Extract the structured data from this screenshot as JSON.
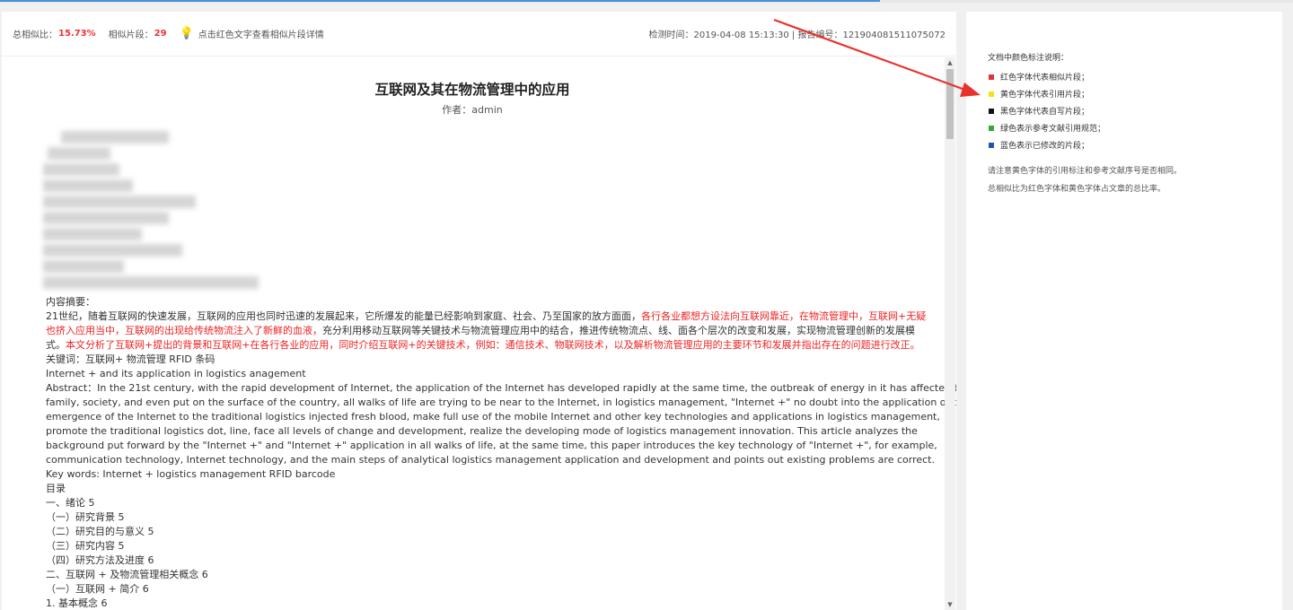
{
  "info_bar": {
    "total_label": "总相似比：",
    "total_value": "15.73%",
    "fragments_label": "相似片段：",
    "fragments_value": "29",
    "hint": "点击红色文字查看相似片段详情",
    "meta": "检测时间：2019-04-08 15:13:30 | 报告编号：121904081511075072"
  },
  "document": {
    "title": "互联网及其在物流管理中的应用",
    "author": "作者：admin",
    "lines": [
      {
        "segments": [
          {
            "text": "内容摘要：",
            "red": false
          }
        ]
      },
      {
        "segments": [
          {
            "text": "21世纪，随着互联网的快速发展，互联网的应用也同时迅速的发展起来，它所爆发的能量已经影响到家庭、社会、乃至国家的放方面面，",
            "red": false
          },
          {
            "text": "各行各业都想方设法向互联网靠近，在物流管理中，互联网+无疑",
            "red": true
          }
        ]
      },
      {
        "segments": [
          {
            "text": "也挤入应用当中，互联网的出现给传统物流注入了新鲜的血液，",
            "red": true
          },
          {
            "text": "充分利用移动互联网等关键技术与物流管理应用中的结合，推进传统物流点、线、面各个层次的改变和发展，实现物流管理创新的发展模",
            "red": false
          }
        ]
      },
      {
        "segments": [
          {
            "text": "式。",
            "red": false
          },
          {
            "text": "本文分析了互联网+提出的背景和互联网+在各行各业的应用，同时介绍互联网+的关键技术，例如：通信技术、物联网技术，以及解析物流管理应用的主要环节和发展并指出存在的问题进行改正。",
            "red": true
          }
        ]
      },
      {
        "segments": [
          {
            "text": "关键词：互联网+ 物流管理 RFID 条码",
            "red": false
          }
        ]
      },
      {
        "segments": [
          {
            "text": "Internet + and its application in logistics anagement",
            "red": false
          }
        ]
      },
      {
        "segments": [
          {
            "text": "Abstract：In the 21st century, with the rapid development of Internet, the application of the Internet has developed rapidly at the same time, the outbreak of energy in it has affected the",
            "red": false
          }
        ]
      },
      {
        "segments": [
          {
            "text": "family, society, and even put on the surface of the country, all walks of life are trying to be near to the Internet, in logistics management, \"Internet +\" no doubt into the application of the",
            "red": false
          }
        ]
      },
      {
        "segments": [
          {
            "text": "emergence of the Internet to the traditional logistics injected fresh blood, make full use of the mobile Internet and other key technologies and applications in logistics management,",
            "red": false
          }
        ]
      },
      {
        "segments": [
          {
            "text": "promote the traditional logistics dot, line, face all levels of change and development, realize the developing mode of logistics management innovation. This article analyzes the",
            "red": false
          }
        ]
      },
      {
        "segments": [
          {
            "text": "background put forward by the \"Internet +\" and \"Internet +\" application in all walks of life, at the same time, this paper introduces the key technology of \"Internet +\", for example,",
            "red": false
          }
        ]
      },
      {
        "segments": [
          {
            "text": "communication technology, Internet technology, and the main steps of analytical logistics management application and development and points out existing problems are correct.",
            "red": false
          }
        ]
      },
      {
        "segments": [
          {
            "text": "Key words: Internet + logistics management RFID barcode",
            "red": false
          }
        ]
      },
      {
        "segments": [
          {
            "text": "目录",
            "red": false
          }
        ]
      },
      {
        "segments": [
          {
            "text": "一、绪论 5",
            "red": false
          }
        ]
      },
      {
        "segments": [
          {
            "text": "（一）研究背景 5",
            "red": false
          }
        ]
      },
      {
        "segments": [
          {
            "text": "（二）研究目的与意义 5",
            "red": false
          }
        ]
      },
      {
        "segments": [
          {
            "text": "（三）研究内容 5",
            "red": false
          }
        ]
      },
      {
        "segments": [
          {
            "text": "（四）研究方法及进度 6",
            "red": false
          }
        ]
      },
      {
        "segments": [
          {
            "text": "二、互联网 + 及物流管理相关概念 6",
            "red": false
          }
        ]
      },
      {
        "segments": [
          {
            "text": "（一）互联网 + 简介 6",
            "red": false
          }
        ]
      },
      {
        "segments": [
          {
            "text": "1. 基本概念 6",
            "red": false
          }
        ]
      }
    ]
  },
  "legend": {
    "title": "文档中颜色标注说明：",
    "items": [
      {
        "color": "#e33333",
        "label": "红色字体代表相似片段；"
      },
      {
        "color": "#f5e20f",
        "label": "黄色字体代表引用片段；"
      },
      {
        "color": "#111111",
        "label": "黑色字体代表自写片段；"
      },
      {
        "color": "#33aa33",
        "label": "绿色表示参考文献引用规范；"
      },
      {
        "color": "#2255aa",
        "label": "蓝色表示已修改的片段；"
      }
    ],
    "notes": [
      "请注意黄色字体的引用标注和参考文献序号是否相同。",
      "总相似比为红色字体和黄色字体占文章的总比率。"
    ]
  },
  "icons": {
    "bulb": "lightbulb-icon",
    "scroll_up": "scroll-up-arrow-icon",
    "scroll_down": "scroll-down-arrow-icon",
    "annotation": "red-annotation-arrow"
  },
  "colors": {
    "accent_red": "#e33333",
    "annotation_arrow": "#e8322c"
  }
}
